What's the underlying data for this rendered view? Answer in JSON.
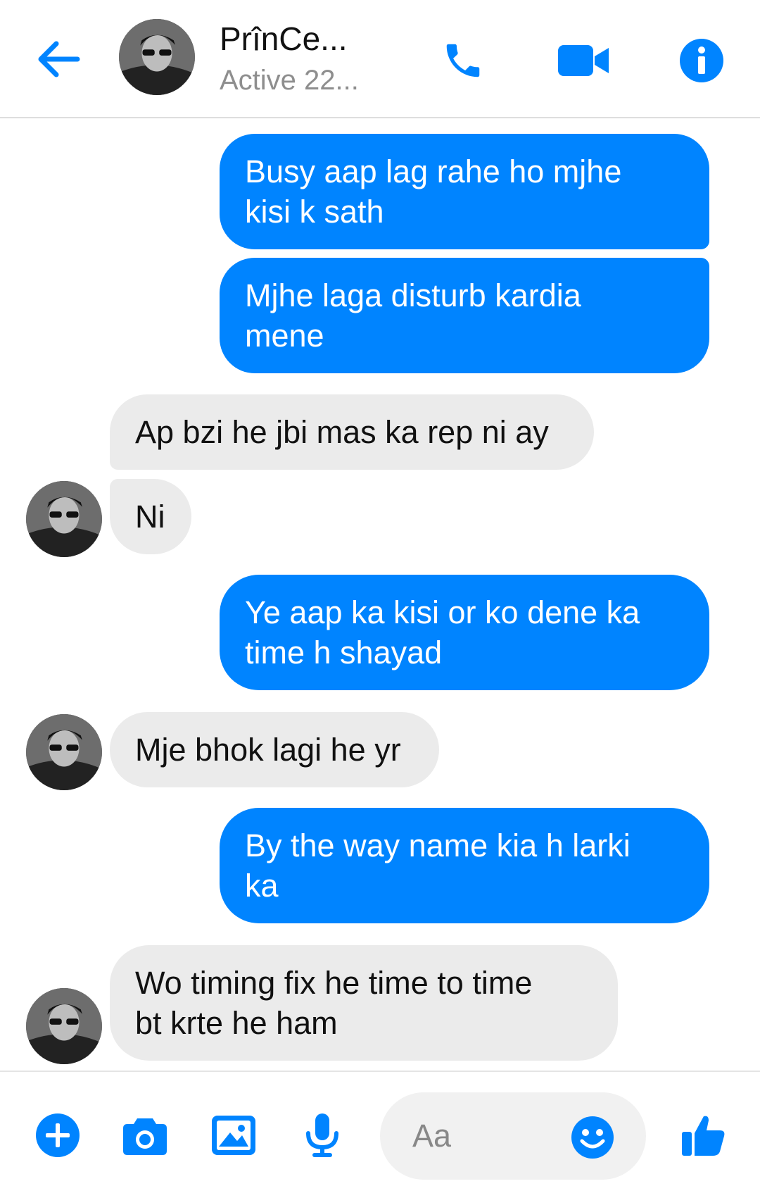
{
  "header": {
    "contact_name": "PrînCe...",
    "status": "Active 22...",
    "icons": [
      "back-arrow-icon",
      "phone-icon",
      "video-camera-icon",
      "info-icon"
    ]
  },
  "messages": [
    {
      "direction": "outgoing",
      "text": "Busy aap lag rahe ho mjhe\nkisi k sath"
    },
    {
      "direction": "outgoing",
      "text": "Mjhe laga disturb kardia\nmene"
    },
    {
      "direction": "incoming",
      "text": "Ap bzi he jbi mas ka rep ni ay"
    },
    {
      "direction": "incoming",
      "text": "Ni"
    },
    {
      "direction": "outgoing",
      "text": "Ye aap ka kisi or ko dene ka\ntime h shayad"
    },
    {
      "direction": "incoming",
      "text": "Mje bhok lagi he yr"
    },
    {
      "direction": "outgoing",
      "text": "By the way name kia h larki\nka"
    },
    {
      "direction": "incoming",
      "text": "Wo timing fix he time to time\nbt krte he ham"
    }
  ],
  "composer": {
    "placeholder": "Aa",
    "icons": [
      "plus-icon",
      "camera-icon",
      "gallery-icon",
      "microphone-icon",
      "emoji-icon",
      "thumbs-up-icon"
    ]
  },
  "colors": {
    "accent": "#0084ff",
    "incoming_bubble": "#ebebeb",
    "outgoing_text": "#ffffff"
  }
}
